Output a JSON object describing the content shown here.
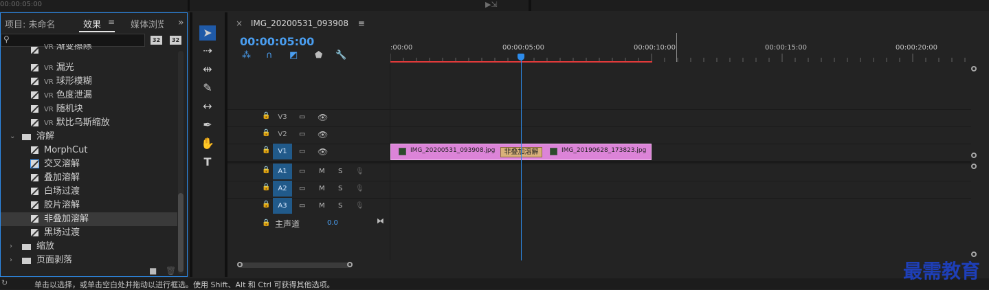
{
  "top": {
    "timecode": "00:00:05:00"
  },
  "effects_panel": {
    "tabs": [
      "项目: 未命名",
      "效果",
      "媒体浏览"
    ],
    "active_tab": "效果",
    "tab_menu_icon": "hamburger-icon",
    "overflow_icon": "chevron-double-right-icon",
    "search_placeholder": "",
    "buttons": [
      "32",
      "32"
    ],
    "tree": [
      {
        "type": "effect",
        "prefix": "VR",
        "label": "渐变擦除",
        "partial": true
      },
      {
        "type": "effect",
        "prefix": "VR",
        "label": "漏光"
      },
      {
        "type": "effect",
        "prefix": "VR",
        "label": "球形模糊"
      },
      {
        "type": "effect",
        "prefix": "VR",
        "label": "色度泄漏"
      },
      {
        "type": "effect",
        "prefix": "VR",
        "label": "随机块"
      },
      {
        "type": "effect",
        "prefix": "VR",
        "label": "默比乌斯缩放"
      },
      {
        "type": "folder",
        "label": "溶解",
        "expanded": true
      },
      {
        "type": "effect",
        "prefix": "",
        "label": "MorphCut"
      },
      {
        "type": "effect",
        "prefix": "",
        "label": "交叉溶解",
        "outlined": true
      },
      {
        "type": "effect",
        "prefix": "",
        "label": "叠加溶解"
      },
      {
        "type": "effect",
        "prefix": "",
        "label": "白场过渡"
      },
      {
        "type": "effect",
        "prefix": "",
        "label": "胶片溶解"
      },
      {
        "type": "effect",
        "prefix": "",
        "label": "非叠加溶解",
        "selected": true
      },
      {
        "type": "effect",
        "prefix": "",
        "label": "黑场过渡"
      },
      {
        "type": "folder",
        "label": "缩放",
        "expanded": false
      },
      {
        "type": "folder",
        "label": "页面剥落",
        "expanded": false
      }
    ]
  },
  "timeline": {
    "sequence_name": "IMG_20200531_093908",
    "close_icon": "×",
    "menu_icon": "hamburger-icon",
    "timecode": "00:00:05:00",
    "ruler_labels": [
      ":00:00",
      "00:00:05:00",
      "00:00:10:00",
      "00:00:15:00",
      "00:00:20:00"
    ],
    "video_tracks": [
      "V3",
      "V2",
      "V1"
    ],
    "audio_tracks": [
      "A1",
      "A2",
      "A3"
    ],
    "audio_m": "M",
    "audio_s": "S",
    "master_label": "主声道",
    "master_value": "0.0",
    "clip_a": "IMG_20200531_093908.jpg",
    "clip_b": "IMG_20190628_173823.jpg",
    "transition_label": "非叠加溶解"
  },
  "status_bar": {
    "text": "单击以选择，或单击空白处并拖动以进行框选。使用 Shift、Alt 和 Ctrl 可获得其他选项。"
  },
  "watermark": "最需教育",
  "colors": {
    "accent": "#2d8ceb",
    "clip": "#dc84d8",
    "workbar": "#e23a3a",
    "transition": "#d9b17a"
  }
}
